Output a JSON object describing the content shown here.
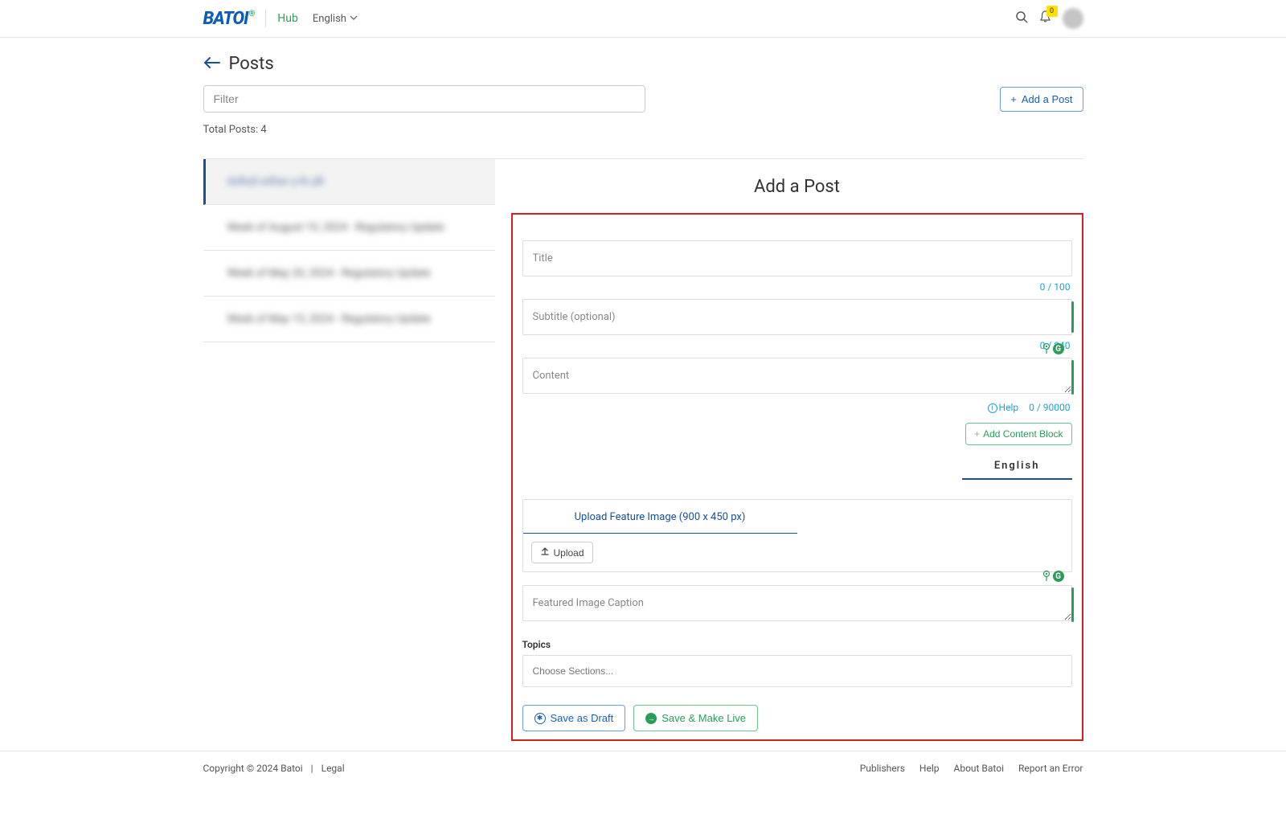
{
  "header": {
    "logo_text": "BATOI",
    "hub_label": "Hub",
    "language": "English",
    "notification_count": "0"
  },
  "page": {
    "title": "Posts",
    "filter_placeholder": "Filter",
    "add_button": "Add a Post",
    "total_label": "Total Posts: 4"
  },
  "posts": [
    {
      "title": "dsRuD either y-th yB"
    },
    {
      "title": "Week of August 10, 2024 - Regulatory Update"
    },
    {
      "title": "Week of May 20, 2024 - Regulatory Update"
    },
    {
      "title": "Week of May 15, 2024 - Regulatory Update"
    }
  ],
  "form": {
    "heading": "Add a Post",
    "title_placeholder": "Title",
    "title_count": "0 / 100",
    "subtitle_placeholder": "Subtitle (optional)",
    "subtitle_count": "0 / 240",
    "content_placeholder": "Content",
    "content_help": "Help",
    "content_count": "0 / 90000",
    "add_content_block": "Add Content Block",
    "language_tab": "English",
    "upload_label": "Upload Feature Image (900 x 450 px)",
    "upload_button": "Upload",
    "caption_placeholder": "Featured Image Caption",
    "topics_label": "Topics",
    "topics_placeholder": "Choose Sections...",
    "save_draft": "Save as Draft",
    "save_live": "Save & Make Live"
  },
  "footer": {
    "copyright": "Copyright © 2024 Batoi",
    "sep": "|",
    "legal": "Legal",
    "links": [
      "Publishers",
      "Help",
      "About Batoi",
      "Report an Error"
    ]
  }
}
